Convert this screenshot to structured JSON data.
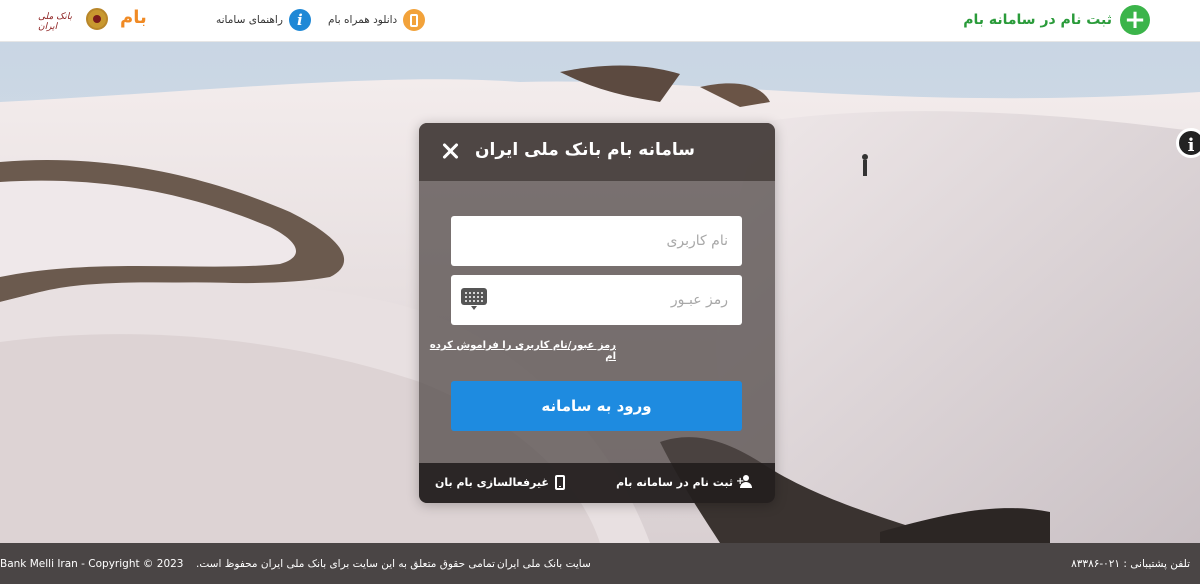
{
  "header": {
    "register_label": "ثبت نام در سامانه بام",
    "register_icon": "plus-circle-icon",
    "mobile_download_label": "دانلود همراه بام",
    "mobile_download_icon": "mobile-phone-icon",
    "guide_label": "راهنمای سامانه",
    "guide_icon": "info-icon",
    "bam_logo_text": "بام",
    "bank_logo_text": "بانک ملی ایران"
  },
  "modal": {
    "title": "سامانه بام بانک ملی ایران",
    "username_placeholder": "نام کاربری",
    "password_placeholder": "رمز عبـور",
    "forgot_link": "رمز عبور/نام کاربری را فراموش کرده ام",
    "login_button": "ورود به سامانه",
    "footer_register": "ثبت نام در سامانه بام",
    "footer_deactivate": "غیرفعالسازی بام بان"
  },
  "footer": {
    "support_phone": "تلفن پشتیبانی : ۰۲۱-۸۳۳۸۶",
    "site_link": "سایت بانک ملی ایران",
    "rights": "تمامی حقوق متعلق به این سایت برای بانک ملی ایران محفوظ است.",
    "copyright": "Bank Melli Iran - Copyright © 2023"
  },
  "colors": {
    "register_green": "#3bb44a",
    "login_blue": "#1e8be0",
    "info_blue": "#1e88d6",
    "mobile_orange": "#f2a23a",
    "footer_bg": "#4a4545"
  }
}
